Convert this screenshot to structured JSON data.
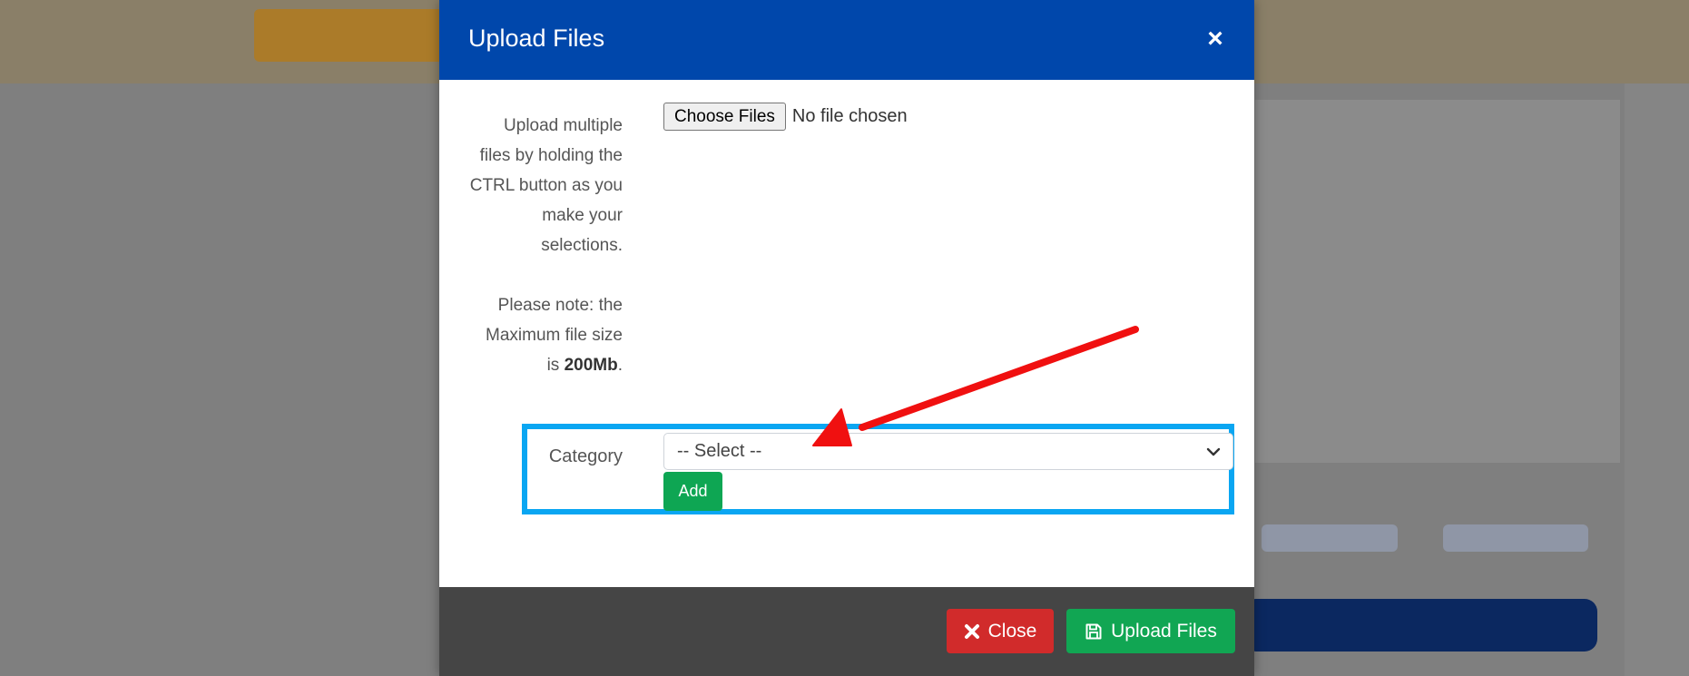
{
  "modal": {
    "title": "Upload Files",
    "close_symbol": "×",
    "help": {
      "line1": "Upload multiple",
      "line2": "files by holding the",
      "line3": "CTRL button as you",
      "line4": "make your",
      "line5": "selections.",
      "note1": "Please note: the",
      "note2": "Maximum file size",
      "note3_prefix": "is ",
      "note3_bold": "200Mb",
      "note3_suffix": "."
    },
    "file_input": {
      "button_label": "Choose Files",
      "status": "No file chosen"
    },
    "category": {
      "label": "Category",
      "selected": "-- Select --",
      "add_label": "Add"
    },
    "footer": {
      "close_label": "Close",
      "upload_label": "Upload Files"
    }
  },
  "colors": {
    "header_blue": "#0047ab",
    "highlight_blue": "#0aa6f2",
    "annotation_red": "#f01010",
    "close_red": "#d12b2b",
    "success_green": "#11a653"
  },
  "icons": {
    "close": "close-icon",
    "dropdown": "chevron-down-icon",
    "close_button": "x-icon",
    "upload_button": "save-icon"
  }
}
